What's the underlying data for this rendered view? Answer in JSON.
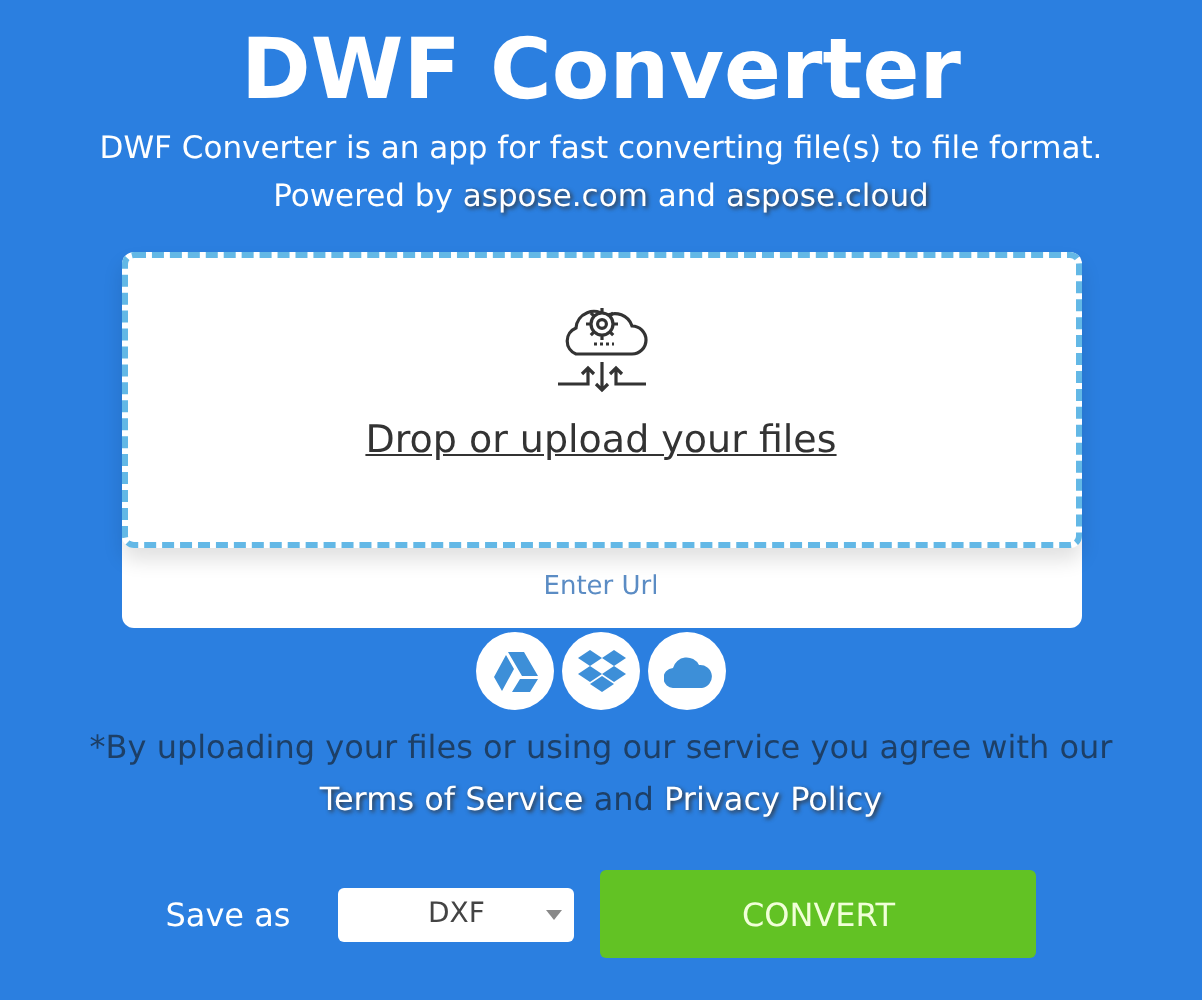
{
  "title": "DWF Converter",
  "subtitle": "DWF Converter is an app for fast converting file(s) to file format.",
  "powered": [
    {
      "kind": "text",
      "text": "Powered by"
    },
    {
      "kind": "link",
      "text": "aspose.com"
    },
    {
      "kind": "text",
      "text": "and"
    },
    {
      "kind": "link",
      "text": "aspose.cloud"
    }
  ],
  "upload": {
    "label": "Drop or upload your files",
    "enter_url": "Enter Url"
  },
  "sources": [
    {
      "kind": "drive"
    },
    {
      "kind": "dropbox"
    },
    {
      "kind": "cloud"
    }
  ],
  "disclaimer": [
    {
      "kind": "text",
      "text": "*By uploading your files or using our service you agree with our"
    },
    {
      "kind": "link",
      "text": "Terms of Service"
    },
    {
      "kind": "text",
      "text": "and"
    },
    {
      "kind": "link",
      "text": "Privacy Policy"
    }
  ],
  "save_as": {
    "label": "Save as",
    "value": "DXF"
  },
  "convert": "CONVERT"
}
